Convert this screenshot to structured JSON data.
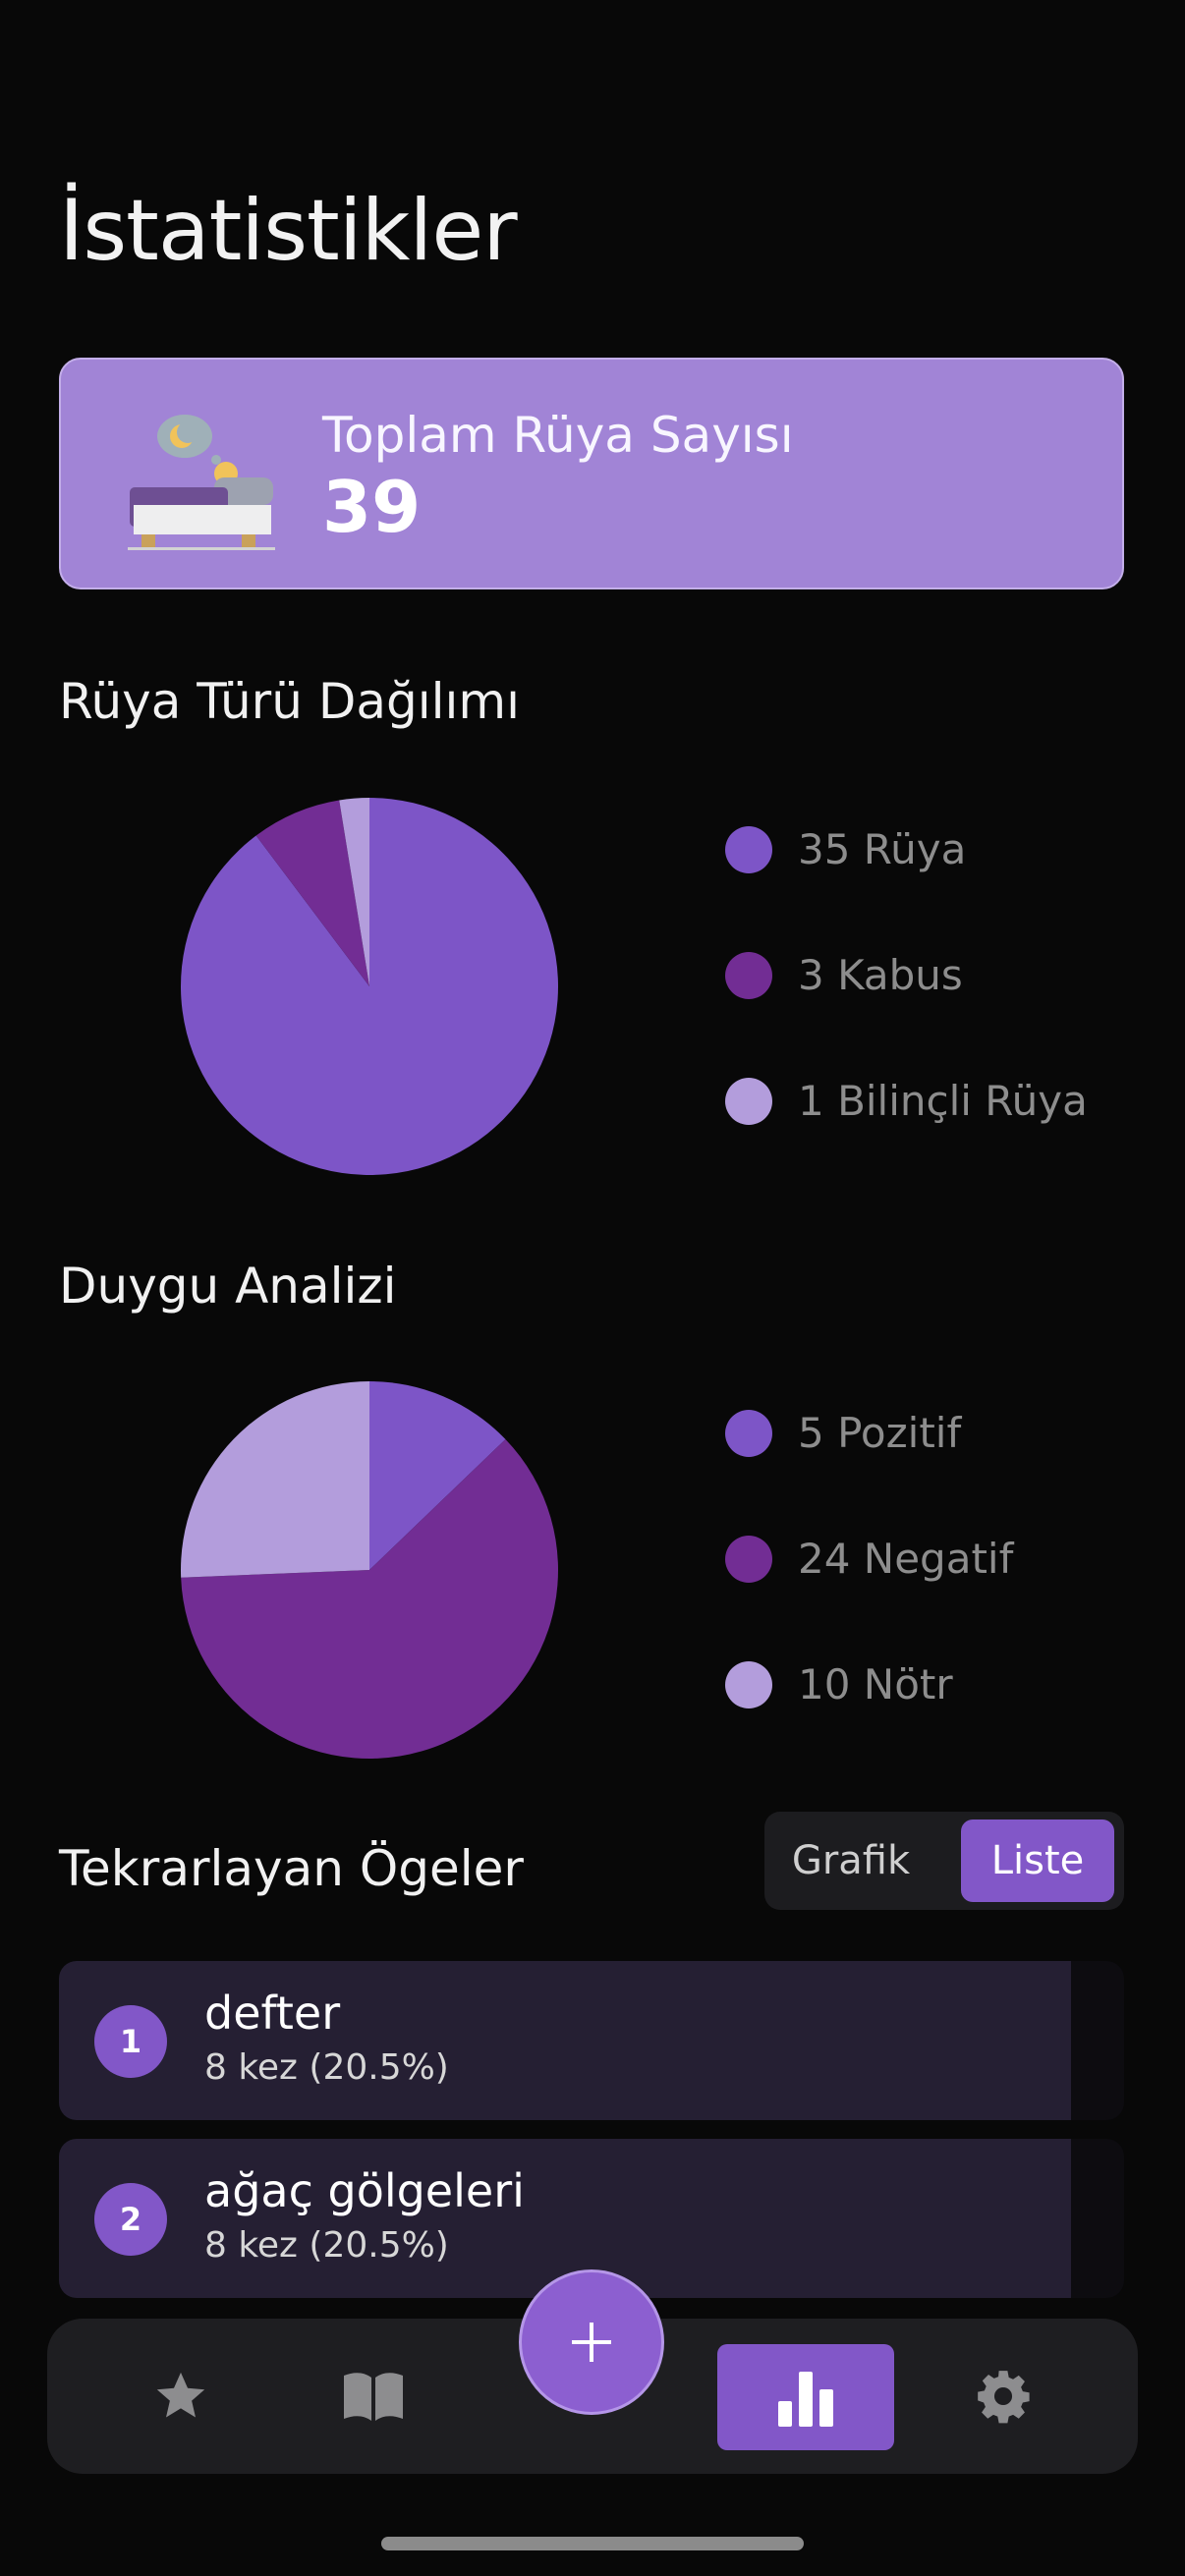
{
  "header": {
    "title": "İstatistikler"
  },
  "summary": {
    "label": "Toplam Rüya Sayısı",
    "value": "39"
  },
  "dream_type": {
    "title": "Rüya Türü Dağılımı",
    "legend": [
      {
        "label": "35 Rüya",
        "value": 35,
        "color": "#7d55c7"
      },
      {
        "label": "3 Kabus",
        "value": 3,
        "color": "#722d94"
      },
      {
        "label": "1 Bilinçli Rüya",
        "value": 1,
        "color": "#b39ddc"
      }
    ]
  },
  "emotion": {
    "title": "Duygu Analizi",
    "legend": [
      {
        "label": "5 Pozitif",
        "value": 5,
        "color": "#7d55c7"
      },
      {
        "label": "24 Negatif",
        "value": 24,
        "color": "#722d94"
      },
      {
        "label": "10 Nötr",
        "value": 10,
        "color": "#b39ddc"
      }
    ]
  },
  "recurring": {
    "title": "Tekrarlayan Ögeler",
    "toggle": {
      "options": [
        "Grafik",
        "Liste"
      ],
      "selected": "Liste"
    },
    "items": [
      {
        "rank": "1",
        "name": "defter",
        "count": "8 kez (20.5%)",
        "share": 0.95
      },
      {
        "rank": "2",
        "name": "ağaç gölgeleri",
        "count": "8 kez (20.5%)",
        "share": 0.95
      }
    ]
  },
  "nav": {
    "items": [
      {
        "icon": "star-icon"
      },
      {
        "icon": "book-icon"
      },
      {
        "icon": "plus-icon"
      },
      {
        "icon": "bar-chart-icon",
        "active": true
      },
      {
        "icon": "gear-icon"
      }
    ]
  },
  "colors": {
    "accent": "#8257c8",
    "card": "#a184d6",
    "list_fill": "#251f33"
  }
}
